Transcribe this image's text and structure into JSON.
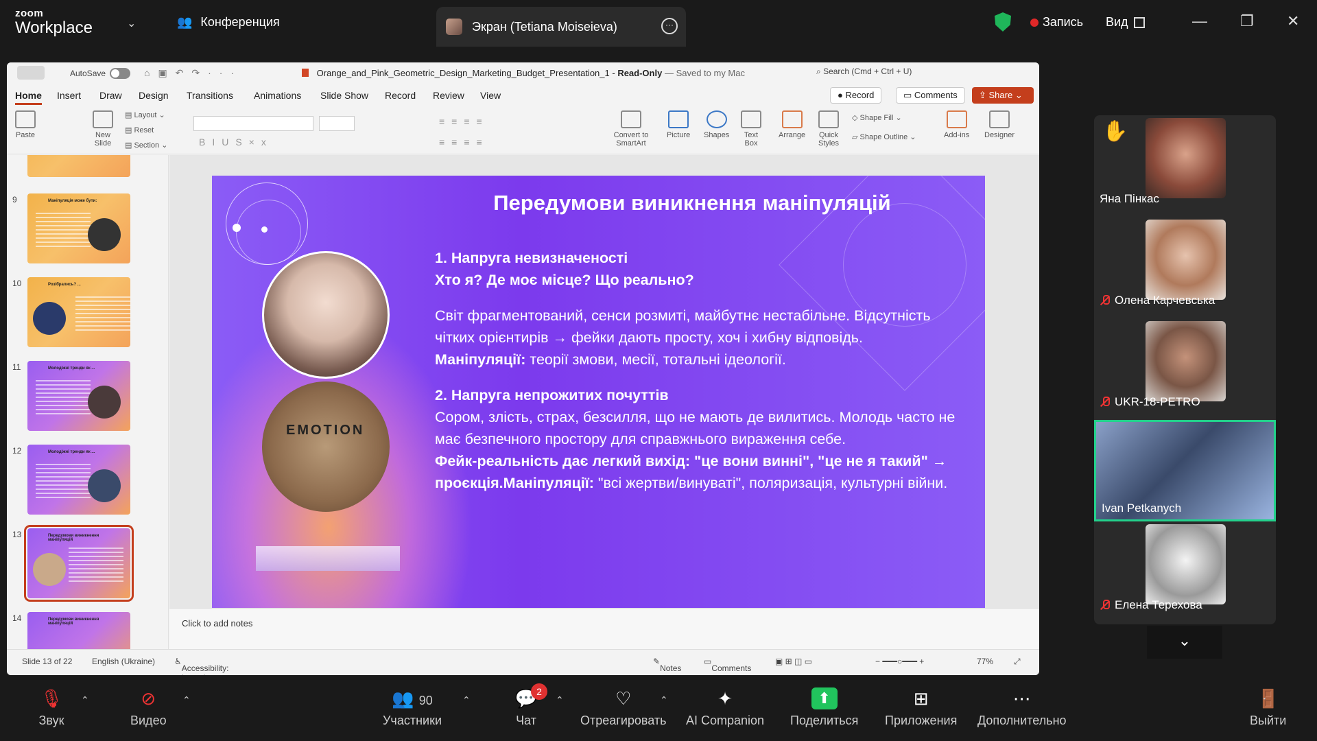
{
  "zoom": {
    "logo_small": "zoom",
    "logo_big": "Workplace",
    "conference_tab": "Конференция",
    "screen_tab": "Экран (Tetiana Moiseieva)",
    "record_label": "Запись",
    "view_label": "Вид"
  },
  "ppt": {
    "autosave": "AutoSave",
    "doc_title": "Orange_and_Pink_Geometric_Design_Marketing_Budget_Presentation_1",
    "doc_status": "Read-Only",
    "doc_saved": "— Saved to my Mac",
    "search": "Search (Cmd + Ctrl + U)",
    "tabs": [
      "Home",
      "Insert",
      "Draw",
      "Design",
      "Transitions",
      "Animations",
      "Slide Show",
      "Record",
      "Review",
      "View"
    ],
    "record_btn": "Record",
    "comments_btn": "Comments",
    "share_btn": "Share",
    "ribbon": {
      "paste": "Paste",
      "new_slide": "New Slide",
      "layout": "Layout",
      "reset": "Reset",
      "section": "Section",
      "convert": "Convert to SmartArt",
      "picture": "Picture",
      "shapes": "Shapes",
      "text_box": "Text Box",
      "arrange": "Arrange",
      "quick_styles": "Quick Styles",
      "shape_fill": "Shape Fill",
      "shape_outline": "Shape Outline",
      "add_ins": "Add-ins",
      "designer": "Designer"
    },
    "thumbnails": [
      {
        "num": "9",
        "title": "Маніпуляція може бути:"
      },
      {
        "num": "10",
        "title": "Розібрались? ..."
      },
      {
        "num": "11",
        "title": "Молодіжні тренди як ..."
      },
      {
        "num": "12",
        "title": "Молодіжні тренди як ..."
      },
      {
        "num": "13",
        "title": "Передумови виникнення маніпуляцій"
      },
      {
        "num": "14",
        "title": "Передумови виникнення маніпуляцій"
      }
    ],
    "slide": {
      "title": "Передумови виникнення маніпуляцій",
      "h1": "1. Напруга невизначеності",
      "h1b": "Хто я? Де моє місце? Що реально?",
      "p1": "Світ фрагментований, сенси розмиті, майбутнє нестабільне. Відсутність чітких орієнтирів → фейки дають просту, хоч і хибну відповідь.",
      "p1_label": "Маніпуляції:",
      "p1_rest": " теорії змови, месії, тотальні ідеології.",
      "h2": "2. Напруга непрожитих почуттів",
      "p2": "Сором, злість, страх, безсилля, що не мають де вилитись. Молодь часто не має безпечного простору для справжнього вираження себе.",
      "p3_bold": "Фейк-реальність дає легкий вихід: \"це вони винні\", \"це не я такий\" → проєкція.Маніпуляції:",
      "p3_rest": " \"всі жертви/винуваті\", поляризація, культурні війни.",
      "tiles": "EMOTION"
    },
    "notes_placeholder": "Click to add notes",
    "status": {
      "slide": "Slide 13 of 22",
      "language": "English (Ukraine)",
      "accessibility": "Accessibility: Investigate",
      "notes": "Notes",
      "comments": "Comments",
      "zoom": "77%"
    }
  },
  "participants": [
    {
      "name": "Яна Пінкас",
      "muted": false,
      "hand": true
    },
    {
      "name": "Олена Карчевська",
      "muted": true
    },
    {
      "name": "UKR-18-PETRO",
      "muted": true
    },
    {
      "name": "Ivan Petkanych",
      "muted": false,
      "active": true
    },
    {
      "name": "Елена Терехова",
      "muted": true
    }
  ],
  "toolbar": {
    "audio": "Звук",
    "video": "Видео",
    "participants": "Участники",
    "participants_count": "90",
    "chat": "Чат",
    "chat_badge": "2",
    "react": "Отреагировать",
    "ai": "AI Companion",
    "share": "Поделиться",
    "apps": "Приложения",
    "more": "Дополнительно",
    "leave": "Выйти"
  }
}
